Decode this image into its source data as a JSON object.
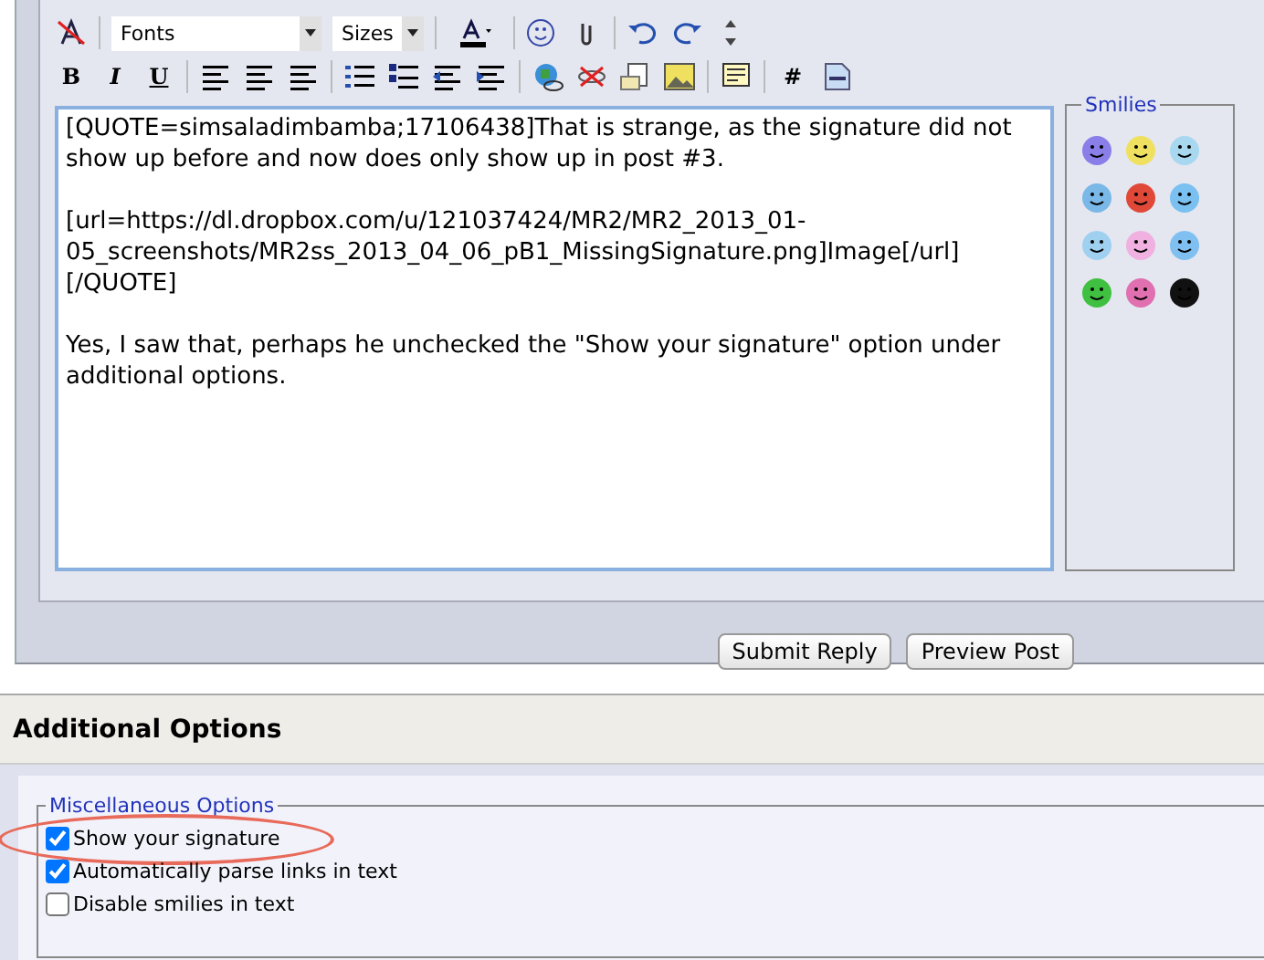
{
  "toolbar": {
    "font_select": "Fonts",
    "size_select": "Sizes",
    "bold": "B",
    "italic": "I",
    "underline": "U",
    "hash": "#"
  },
  "message": {
    "value": "[QUOTE=simsaladimbamba;17106438]That is strange, as the signature did not show up before and now does only show up in post #3.\n\n[url=https://dl.dropbox.com/u/121037424/MR2/MR2_2013_01-05_screenshots/MR2ss_2013_04_06_pB1_MissingSignature.png]Image[/url]\n[/QUOTE]\n\nYes, I saw that, perhaps he unchecked the \"Show your signature\" option under additional options."
  },
  "smilies": {
    "title": "Smilies",
    "items": [
      {
        "color": "#8a7ee8"
      },
      {
        "color": "#f0e060"
      },
      {
        "color": "#a8d8f0"
      },
      {
        "color": "#7ab8e8"
      },
      {
        "color": "#e04838"
      },
      {
        "color": "#7ac0f0"
      },
      {
        "color": "#a0d0f0"
      },
      {
        "color": "#f0b0e0"
      },
      {
        "color": "#80c0f0"
      },
      {
        "color": "#40c040"
      },
      {
        "color": "#e070b0"
      },
      {
        "color": "#111111"
      }
    ]
  },
  "buttons": [
    "Submit Reply",
    "Preview Post"
  ],
  "additional_options": {
    "title": "Additional Options",
    "group_title": "Miscellaneous Options",
    "options": [
      {
        "label": "Show your signature",
        "checked": true,
        "highlighted": true
      },
      {
        "label": "Automatically parse links in text",
        "checked": true,
        "highlighted": false
      },
      {
        "label": "Disable smilies in text",
        "checked": false,
        "highlighted": false
      }
    ]
  }
}
